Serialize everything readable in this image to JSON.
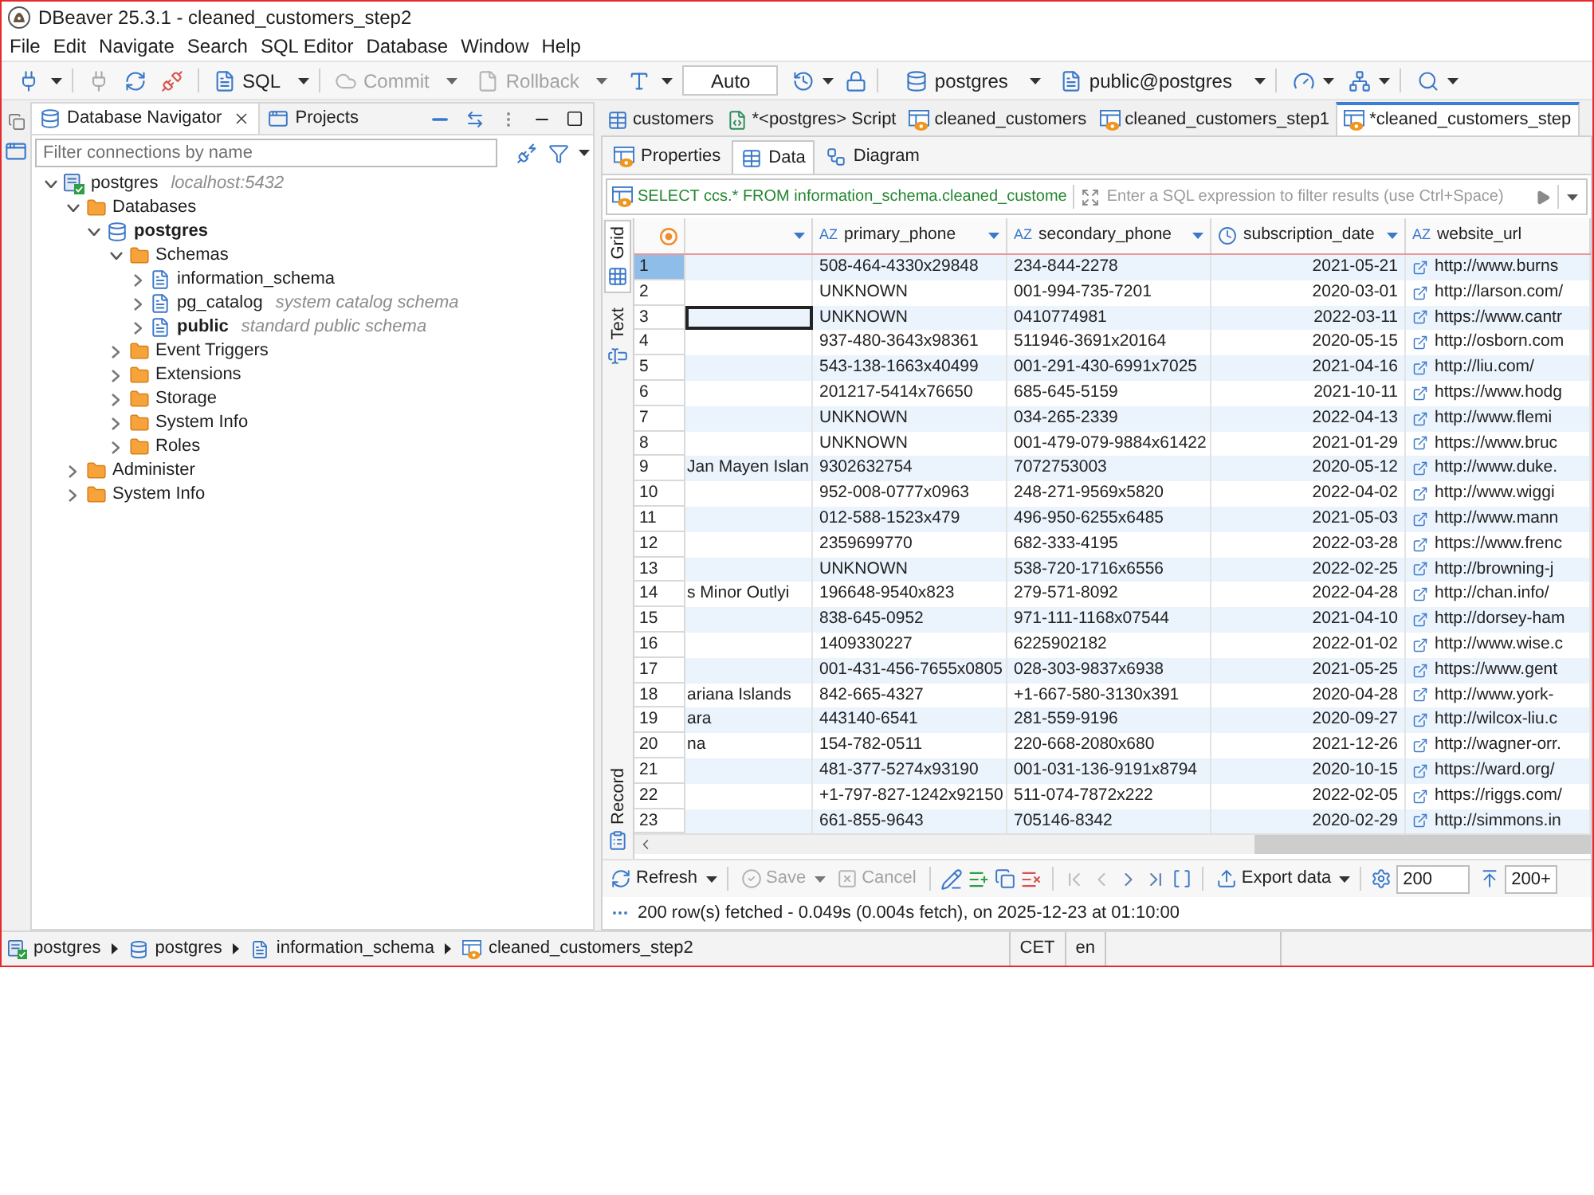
{
  "window": {
    "title": "DBeaver 25.3.1 - cleaned_customers_step2"
  },
  "menu": [
    "File",
    "Edit",
    "Navigate",
    "Search",
    "SQL Editor",
    "Database",
    "Window",
    "Help"
  ],
  "toolbar": {
    "sql": {
      "label": "SQL",
      "disabled": false
    },
    "commit": {
      "label": "Commit",
      "disabled": true
    },
    "rollback": {
      "label": "Rollback",
      "disabled": true
    },
    "transaction_mode": "Auto",
    "connection": "postgres",
    "schema": "public@postgres"
  },
  "navigator": {
    "tabs": [
      {
        "kind": "navigator",
        "label": "Database Navigator",
        "selected": true
      },
      {
        "kind": "project",
        "label": "Projects",
        "selected": false
      }
    ],
    "filter": {
      "placeholder": "Filter connections by name"
    },
    "tree": [
      {
        "kind": "connection",
        "label": "postgres",
        "description": "localhost:5432",
        "expanded": true,
        "active": false,
        "children": [
          {
            "kind": "folder",
            "label": "Databases",
            "expanded": true,
            "active": false,
            "children": [
              {
                "kind": "database",
                "label": "postgres",
                "expanded": true,
                "active": true,
                "children": [
                  {
                    "kind": "folder",
                    "label": "Schemas",
                    "expanded": true,
                    "active": false,
                    "children": [
                      {
                        "kind": "schema",
                        "label": "information_schema",
                        "expanded": false,
                        "active": false
                      },
                      {
                        "kind": "schema",
                        "label": "pg_catalog",
                        "description": "system catalog schema",
                        "expanded": false,
                        "active": false
                      },
                      {
                        "kind": "schema",
                        "label": "public",
                        "description": "standard public schema",
                        "expanded": false,
                        "active": true
                      }
                    ]
                  },
                  {
                    "kind": "folder",
                    "label": "Event Triggers",
                    "expanded": false,
                    "active": false
                  },
                  {
                    "kind": "folder",
                    "label": "Extensions",
                    "expanded": false,
                    "active": false
                  },
                  {
                    "kind": "folder",
                    "label": "Storage",
                    "expanded": false,
                    "active": false
                  },
                  {
                    "kind": "folder",
                    "label": "System Info",
                    "expanded": false,
                    "active": false
                  },
                  {
                    "kind": "folder",
                    "label": "Roles",
                    "expanded": false,
                    "active": false
                  }
                ]
              }
            ]
          },
          {
            "kind": "folder",
            "label": "Administer",
            "expanded": false,
            "active": false
          },
          {
            "kind": "folder",
            "label": "System Info",
            "expanded": false,
            "active": false
          }
        ]
      }
    ]
  },
  "editor": {
    "tabs": [
      {
        "kind": "table",
        "label": "customers",
        "selected": false
      },
      {
        "kind": "script",
        "label": "*<postgres> Script",
        "selected": false
      },
      {
        "kind": "view",
        "label": "cleaned_customers",
        "selected": false
      },
      {
        "kind": "view",
        "label": "cleaned_customers_step1",
        "selected": false
      },
      {
        "kind": "view",
        "label": "*cleaned_customers_step",
        "selected": true
      }
    ],
    "subtabs": [
      {
        "kind": "properties",
        "label": "Properties",
        "selected": false
      },
      {
        "kind": "data",
        "label": "Data",
        "selected": true
      },
      {
        "kind": "diagram",
        "label": "Diagram",
        "selected": false
      }
    ],
    "query": "SELECT ccs.* FROM information_schema.cleaned_custome",
    "filter": {
      "placeholder": "Enter a SQL expression to filter results (use Ctrl+Space)"
    },
    "view_tabs": [
      {
        "kind": "grid",
        "label": "Grid",
        "selected": true
      },
      {
        "kind": "text",
        "label": "Text",
        "selected": false
      },
      {
        "kind": "record",
        "label": "Record",
        "selected": false
      }
    ],
    "grid": {
      "columns": [
        {
          "kind": "clipped"
        },
        {
          "kind": "string",
          "type_text": "AZ",
          "label": "primary_phone"
        },
        {
          "kind": "string",
          "type_text": "AZ",
          "label": "secondary_phone"
        },
        {
          "kind": "date",
          "label": "subscription_date"
        },
        {
          "kind": "url",
          "type_text": "AZ",
          "label": "website_url"
        }
      ],
      "rows": [
        {
          "number": "1",
          "selected": true,
          "focused": false,
          "values": [
            "508-464-4330x29848",
            "234-844-2278",
            "2021-05-21",
            "http://www.burns"
          ]
        },
        {
          "number": "2",
          "selected": false,
          "focused": false,
          "values": [
            "UNKNOWN",
            "001-994-735-7201",
            "2020-03-01",
            "http://larson.com/"
          ]
        },
        {
          "number": "3",
          "selected": false,
          "focused": true,
          "values": [
            "UNKNOWN",
            "0410774981",
            "2022-03-11",
            "https://www.cantr"
          ]
        },
        {
          "number": "4",
          "selected": false,
          "focused": false,
          "values": [
            "937-480-3643x98361",
            "511946-3691x20164",
            "2020-05-15",
            "http://osborn.com"
          ]
        },
        {
          "number": "5",
          "selected": false,
          "focused": false,
          "values": [
            "543-138-1663x40499",
            "001-291-430-6991x7025",
            "2021-04-16",
            "http://liu.com/"
          ]
        },
        {
          "number": "6",
          "selected": false,
          "focused": false,
          "values": [
            "201217-5414x76650",
            "685-645-5159",
            "2021-10-11",
            "https://www.hodg"
          ]
        },
        {
          "number": "7",
          "selected": false,
          "focused": false,
          "values": [
            "UNKNOWN",
            "034-265-2339",
            "2022-04-13",
            "http://www.flemi"
          ]
        },
        {
          "number": "8",
          "selected": false,
          "focused": false,
          "values": [
            "UNKNOWN",
            "001-479-079-9884x61422",
            "2021-01-29",
            "https://www.bruc"
          ]
        },
        {
          "number": "9",
          "selected": false,
          "focused": false,
          "column_1": "Jan Mayen Islan",
          "values": [
            "9302632754",
            "7072753003",
            "2020-05-12",
            "http://www.duke."
          ]
        },
        {
          "number": "10",
          "selected": false,
          "focused": false,
          "values": [
            "952-008-0777x0963",
            "248-271-9569x5820",
            "2022-04-02",
            "http://www.wiggi"
          ]
        },
        {
          "number": "11",
          "selected": false,
          "focused": false,
          "values": [
            "012-588-1523x479",
            "496-950-6255x6485",
            "2021-05-03",
            "http://www.mann"
          ]
        },
        {
          "number": "12",
          "selected": false,
          "focused": false,
          "values": [
            "2359699770",
            "682-333-4195",
            "2022-03-28",
            "https://www.frenc"
          ]
        },
        {
          "number": "13",
          "selected": false,
          "focused": false,
          "values": [
            "UNKNOWN",
            "538-720-1716x6556",
            "2022-02-25",
            "http://browning-j"
          ]
        },
        {
          "number": "14",
          "selected": false,
          "focused": false,
          "column_1": "s Minor Outlyi",
          "values": [
            "196648-9540x823",
            "279-571-8092",
            "2022-04-28",
            "http://chan.info/"
          ]
        },
        {
          "number": "15",
          "selected": false,
          "focused": false,
          "values": [
            "838-645-0952",
            "971-111-1168x07544",
            "2021-04-10",
            "http://dorsey-ham"
          ]
        },
        {
          "number": "16",
          "selected": false,
          "focused": false,
          "values": [
            "1409330227",
            "6225902182",
            "2022-01-02",
            "http://www.wise.c"
          ]
        },
        {
          "number": "17",
          "selected": false,
          "focused": false,
          "values": [
            "001-431-456-7655x0805",
            "028-303-9837x6938",
            "2021-05-25",
            "https://www.gent"
          ]
        },
        {
          "number": "18",
          "selected": false,
          "focused": false,
          "column_1": "ariana Islands",
          "values": [
            "842-665-4327",
            "+1-667-580-3130x391",
            "2020-04-28",
            "http://www.york-"
          ]
        },
        {
          "number": "19",
          "selected": false,
          "focused": false,
          "column_1": "ara",
          "values": [
            "443140-6541",
            "281-559-9196",
            "2020-09-27",
            "http://wilcox-liu.c"
          ]
        },
        {
          "number": "20",
          "selected": false,
          "focused": false,
          "column_1": "na",
          "values": [
            "154-782-0511",
            "220-668-2080x680",
            "2021-12-26",
            "http://wagner-orr."
          ]
        },
        {
          "number": "21",
          "selected": false,
          "focused": false,
          "values": [
            "481-377-5274x93190",
            "001-031-136-9191x8794",
            "2020-10-15",
            "https://ward.org/"
          ]
        },
        {
          "number": "22",
          "selected": false,
          "focused": false,
          "values": [
            "+1-797-827-1242x92150",
            "511-074-7872x222",
            "2022-02-05",
            "https://riggs.com/"
          ]
        },
        {
          "number": "23",
          "selected": false,
          "focused": false,
          "values": [
            "661-855-9643",
            "705146-8342",
            "2020-02-29",
            "http://simmons.in"
          ]
        }
      ]
    },
    "actions": {
      "refresh": {
        "label": "Refresh",
        "disabled": false
      },
      "save": {
        "label": "Save",
        "disabled": true
      },
      "cancel": {
        "label": "Cancel",
        "disabled": true
      },
      "navigation": [
        {
          "kind": "first",
          "disabled": true
        },
        {
          "kind": "previous",
          "disabled": true
        },
        {
          "kind": "next",
          "disabled": false
        },
        {
          "kind": "last",
          "disabled": false
        }
      ],
      "export": {
        "label": "Export data",
        "disabled": false
      },
      "fetch_size": {
        "value": "200"
      },
      "fetch_more": "200+"
    },
    "status": "200 row(s) fetched - 0.049s (0.004s fetch), on 2025-12-23 at 01:10:00"
  },
  "status_bar": {
    "breadcrumb": [
      {
        "kind": "connection",
        "label": "postgres"
      },
      {
        "kind": "database",
        "label": "postgres"
      },
      {
        "kind": "schema",
        "label": "information_schema"
      },
      {
        "kind": "view",
        "label": "cleaned_customers_step2"
      }
    ],
    "timezone": "CET",
    "locale": "en"
  }
}
